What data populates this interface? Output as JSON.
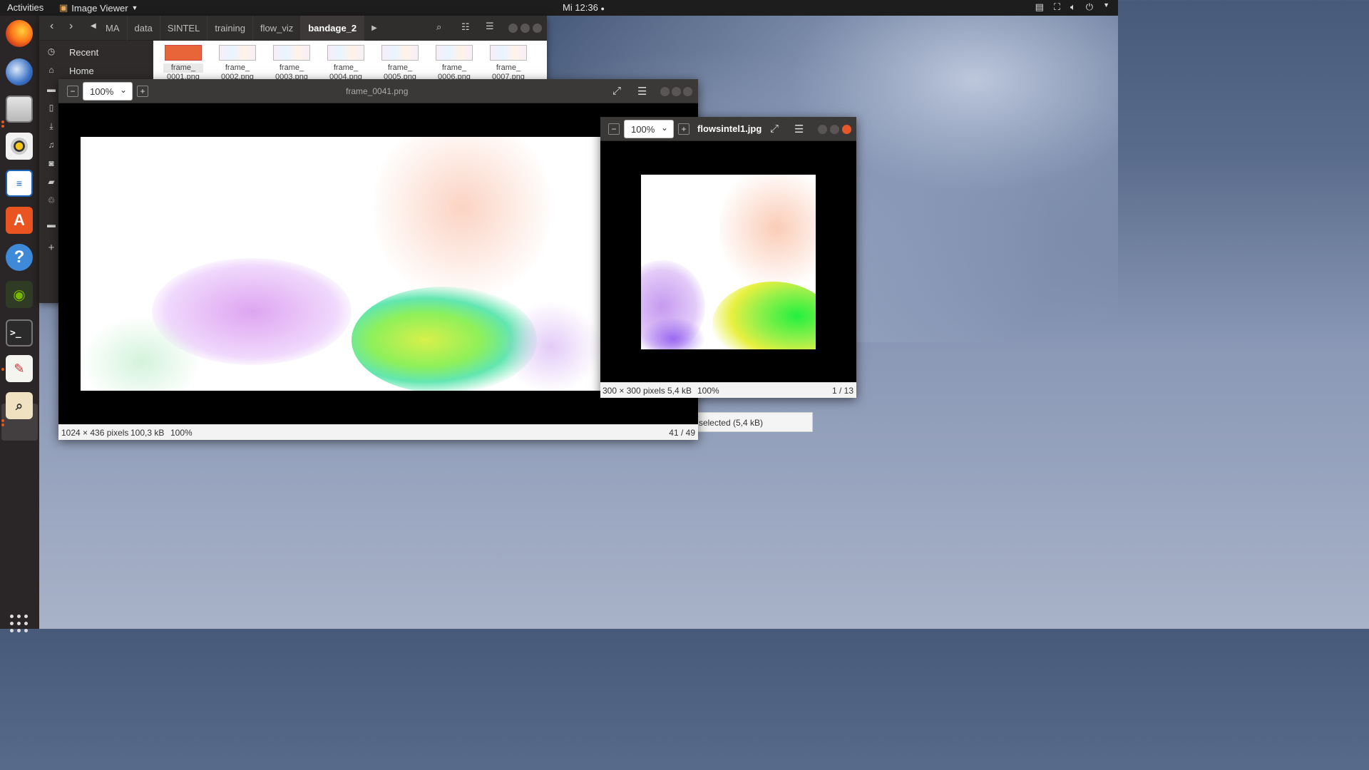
{
  "topbar": {
    "activities": "Activities",
    "app_menu": "Image Viewer",
    "clock": "Mi 12:36"
  },
  "dock": {
    "icons": [
      "firefox-icon",
      "thunderbird-icon",
      "files-icon",
      "rhythmbox-icon",
      "libreoffice-writer-icon",
      "software-center-icon",
      "help-icon",
      "nvidia-icon",
      "terminal-icon",
      "text-editor-icon",
      "image-viewer-icon",
      "show-apps-icon"
    ]
  },
  "files": {
    "breadcrumbs": [
      "MA",
      "data",
      "SINTEL",
      "training",
      "flow_viz",
      "bandage_2"
    ],
    "sidebar": [
      {
        "label": "Recent",
        "icon": "clock-icon"
      },
      {
        "label": "Home",
        "icon": "home-icon"
      },
      {
        "label": "",
        "icon": "folder-icon"
      },
      {
        "label": "",
        "icon": "document-icon"
      },
      {
        "label": "",
        "icon": "download-icon"
      },
      {
        "label": "",
        "icon": "music-icon"
      },
      {
        "label": "",
        "icon": "camera-icon"
      },
      {
        "label": "",
        "icon": "video-icon"
      },
      {
        "label": "",
        "icon": "trash-icon"
      },
      {
        "label": "",
        "icon": "folder-icon"
      },
      {
        "label": "",
        "icon": "plus-icon"
      }
    ],
    "items": [
      {
        "line1": "frame_",
        "line2": "0001.png",
        "selected": true
      },
      {
        "line1": "frame_",
        "line2": "0002.png",
        "selected": false
      },
      {
        "line1": "frame_",
        "line2": "0003.png",
        "selected": false
      },
      {
        "line1": "frame_",
        "line2": "0004.png",
        "selected": false
      },
      {
        "line1": "frame_",
        "line2": "0005.png",
        "selected": false
      },
      {
        "line1": "frame_",
        "line2": "0006.png",
        "selected": false
      },
      {
        "line1": "frame_",
        "line2": "0007.png",
        "selected": false
      }
    ],
    "status": "ntel1.jpg\" selected  (5,4 kB)"
  },
  "viewer1": {
    "zoom": "100%",
    "title": "frame_0041.png",
    "status_dims": "1024 × 436 pixels",
    "status_size": "100,3 kB",
    "status_zoom": "100%",
    "status_index": "41 / 49"
  },
  "viewer2": {
    "zoom": "100%",
    "title": "flowsintel1.jpg",
    "status_dims": "300 × 300 pixels",
    "status_size": "5,4 kB",
    "status_zoom": "100%",
    "status_index": "1 / 13"
  },
  "colors": {
    "accent": "#e95420",
    "panel": "#1d1d1d",
    "headerbar": "#3b3838"
  }
}
